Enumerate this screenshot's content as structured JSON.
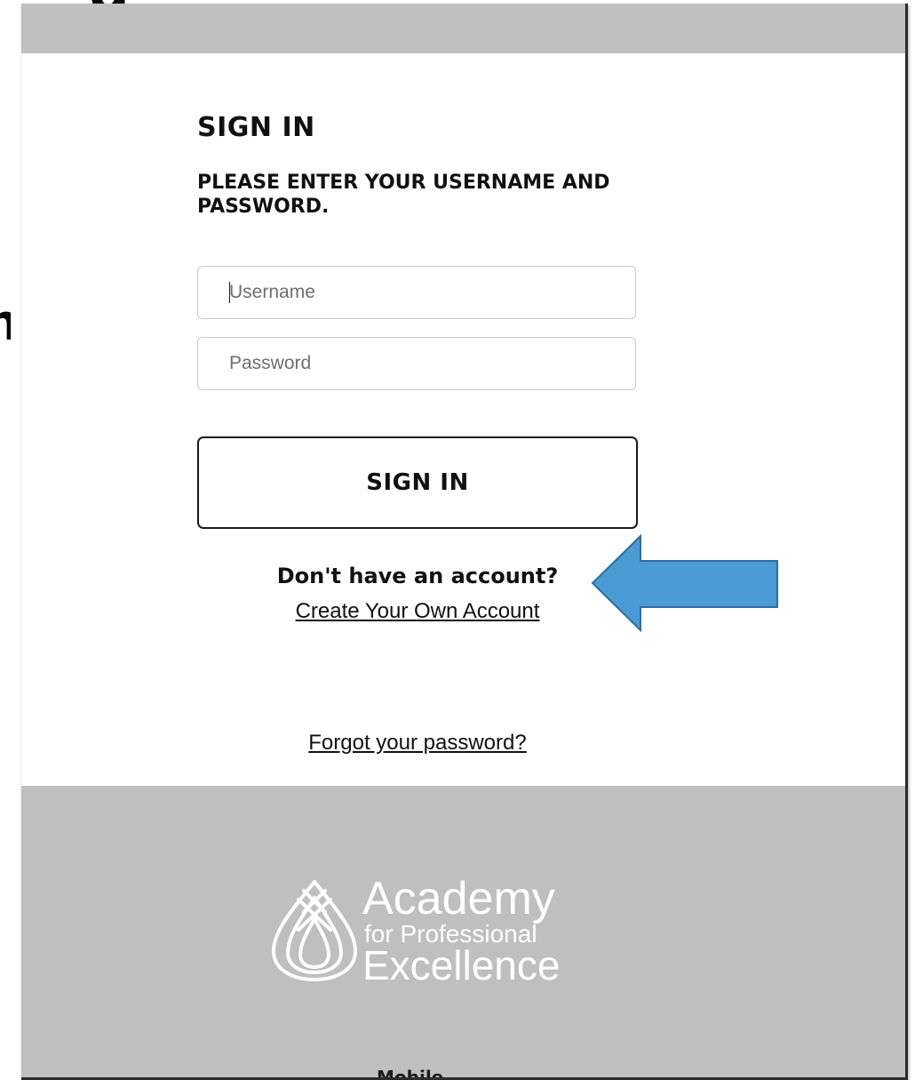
{
  "background": {
    "cut_off_top_text": "g",
    "cut_off_left_text": "n"
  },
  "login": {
    "title": "SIGN IN",
    "subtitle": "PLEASE ENTER YOUR USERNAME AND PASSWORD.",
    "username": {
      "placeholder": "Username",
      "value": ""
    },
    "password": {
      "placeholder": "Password",
      "value": ""
    },
    "sign_in_label": "SIGN IN",
    "no_account_text": "Don't have an account?",
    "create_account_link": "Create Your Own Account",
    "forgot_password_link": "Forgot your password?"
  },
  "footer": {
    "logo": {
      "line1": "Academy",
      "line2": "for Professional",
      "line3": "Excellence",
      "icon": "academy-flame-logo-icon"
    },
    "cut_off_text": "Mobile"
  },
  "annotation": {
    "icon": "left-arrow-callout-icon",
    "fill_color": "#4a9bd4",
    "stroke_color": "#2d6f9f"
  },
  "colors": {
    "band_gray": "#bfbfbf",
    "text_dark": "#111111",
    "input_border": "#c8c8c8"
  }
}
